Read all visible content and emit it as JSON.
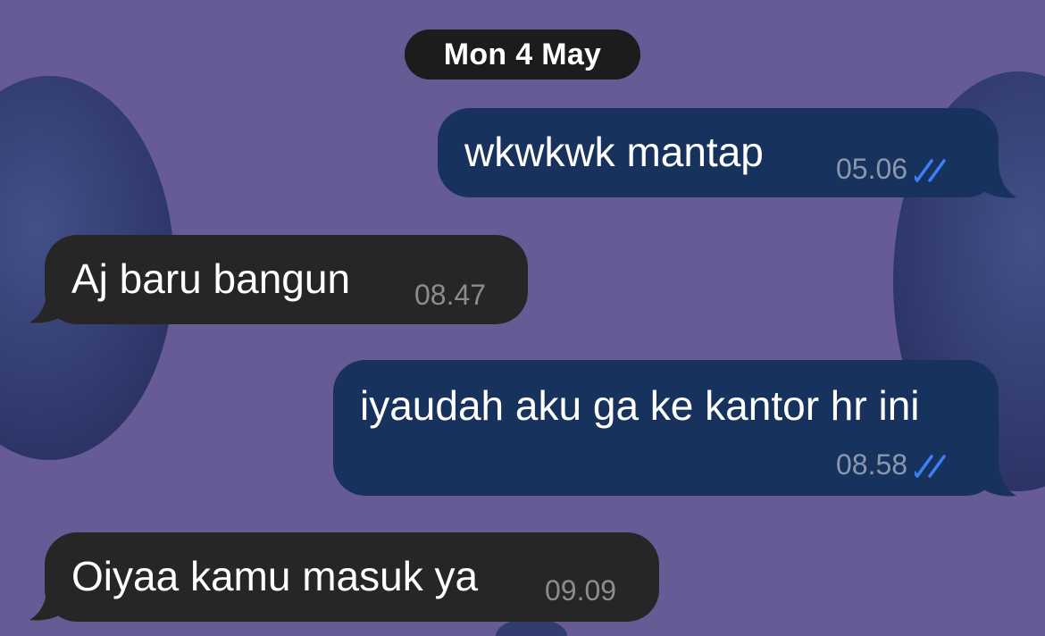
{
  "colors": {
    "background": "#665b95",
    "outgoing_bubble": "#17325c",
    "incoming_bubble": "#262626",
    "date_chip": "#1c1c1c",
    "read_ticks": "#3d7ff5"
  },
  "chat": {
    "date_separator": "Mon 4 May",
    "messages": [
      {
        "direction": "outgoing",
        "text": "wkwkwk mantap",
        "time": "05.06",
        "status_icon": "double-check-read-icon"
      },
      {
        "direction": "incoming",
        "text": "Aj baru bangun",
        "time": "08.47"
      },
      {
        "direction": "outgoing",
        "text": "iyaudah aku ga ke kantor hr ini",
        "time": "08.58",
        "status_icon": "double-check-read-icon"
      },
      {
        "direction": "incoming",
        "text": "Oiyaa kamu masuk ya",
        "time": "09.09"
      }
    ]
  }
}
